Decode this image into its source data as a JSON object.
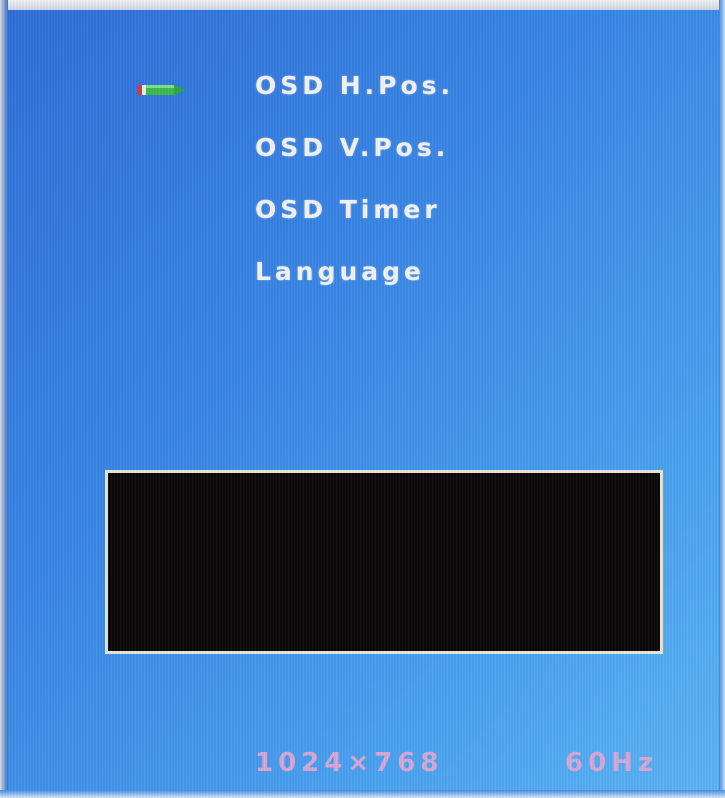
{
  "osd_menu": {
    "items": [
      {
        "label": "OSD H.Pos."
      },
      {
        "label": "OSD V.Pos."
      },
      {
        "label": "OSD Timer"
      },
      {
        "label": "Language"
      }
    ],
    "selected_index": 0
  },
  "status": {
    "resolution": "1024×768",
    "refresh_rate": "60Hz"
  },
  "icons": {
    "selection_cursor": "pointer-arrow-icon"
  },
  "colors": {
    "background": "#3a86e6",
    "menu_text": "#f4f4f4",
    "status_text": "#d9a7d6",
    "preview_box": "#0a0808",
    "preview_border": "#e8e6d6"
  }
}
